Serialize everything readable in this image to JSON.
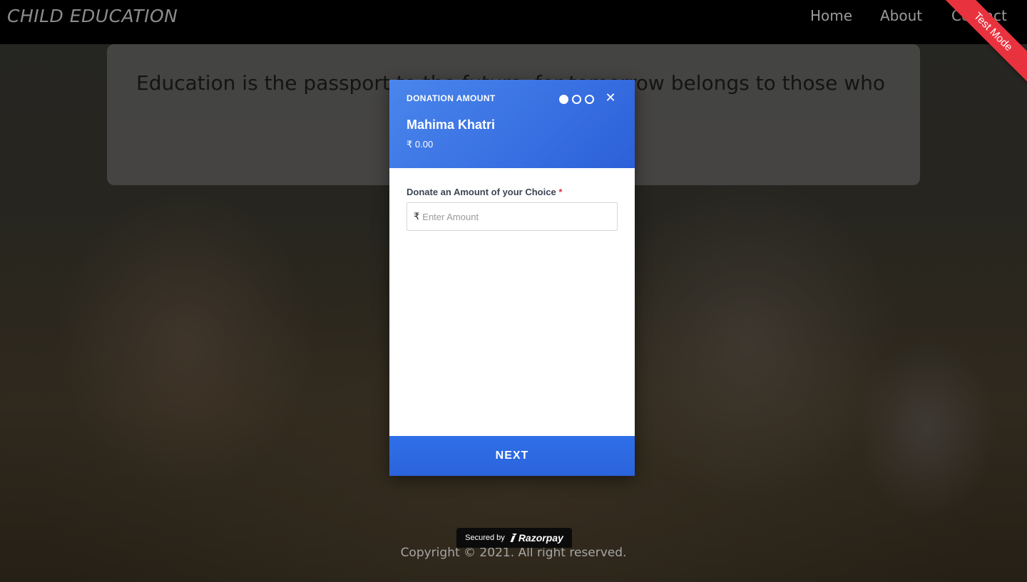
{
  "site": {
    "brand": "CHILD EDUCATION",
    "nav": {
      "home": "Home",
      "about": "About",
      "contact": "Contact"
    },
    "ribbon": "Test Mode",
    "quote": "Education is the passport to the future, for tomorrow belongs to those who",
    "copyright": "Copyright © 2021. All right reserved."
  },
  "checkout": {
    "step_title": "DONATION AMOUNT",
    "steps_total": 3,
    "step_active": 1,
    "close_icon": "close-icon",
    "merchant_name": "Mahima Khatri",
    "amount_summary": "₹ 0.00",
    "field_label": "Donate an Amount of your Choice",
    "required_mark": "*",
    "currency_symbol": "₹",
    "amount_placeholder": "Enter Amount",
    "amount_value": "",
    "next_label": "NEXT",
    "secured_by": "Secured by",
    "provider": "Razorpay",
    "colors": {
      "header": "#3b73e3",
      "button": "#2f6fe7",
      "required": "#e5333c"
    }
  }
}
